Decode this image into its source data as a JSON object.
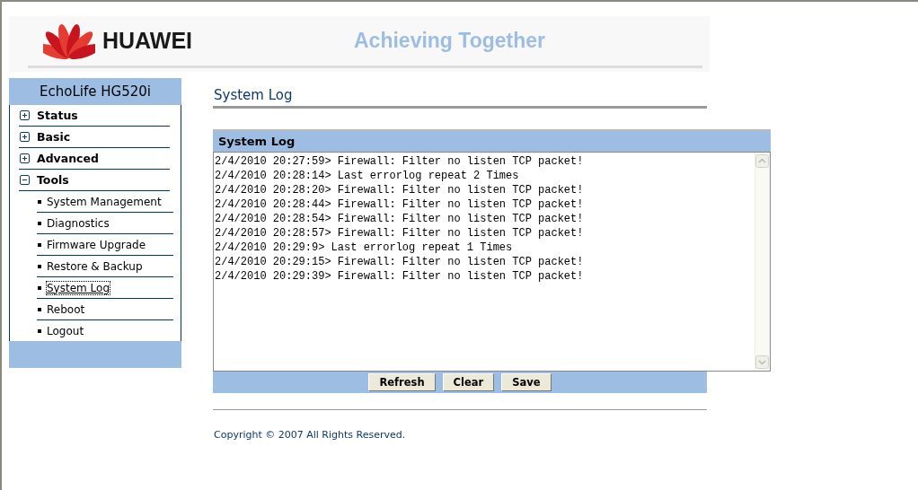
{
  "header": {
    "brand": "HUAWEI",
    "slogan": "Achieving Together"
  },
  "sidebar": {
    "title": "EchoLife HG520i",
    "items": [
      {
        "label": "Status",
        "expanded": false
      },
      {
        "label": "Basic",
        "expanded": false
      },
      {
        "label": "Advanced",
        "expanded": false
      },
      {
        "label": "Tools",
        "expanded": true,
        "children": [
          {
            "label": "System Management",
            "selected": false
          },
          {
            "label": "Diagnostics",
            "selected": false
          },
          {
            "label": "Firmware Upgrade",
            "selected": false
          },
          {
            "label": "Restore & Backup",
            "selected": false
          },
          {
            "label": "System Log",
            "selected": true
          },
          {
            "label": "Reboot",
            "selected": false
          },
          {
            "label": "Logout",
            "selected": false
          }
        ]
      }
    ]
  },
  "page_title": "System Log",
  "log": {
    "title": "System Log",
    "lines": [
      "2/4/2010 20:27:59> Firewall: Filter no listen TCP packet!",
      "2/4/2010 20:28:14> Last errorlog repeat 2 Times",
      "2/4/2010 20:28:20> Firewall: Filter no listen TCP packet!",
      "2/4/2010 20:28:44> Firewall: Filter no listen TCP packet!",
      "2/4/2010 20:28:54> Firewall: Filter no listen TCP packet!",
      "2/4/2010 20:28:57> Firewall: Filter no listen TCP packet!",
      "2/4/2010 20:29:9> Last errorlog repeat 1 Times",
      "2/4/2010 20:29:15> Firewall: Filter no listen TCP packet!",
      "2/4/2010 20:29:39> Firewall: Filter no listen TCP packet!"
    ]
  },
  "buttons": [
    "Refresh",
    "Clear",
    "Save"
  ],
  "copyright": "Copyright © 2007 All Rights Reserved."
}
